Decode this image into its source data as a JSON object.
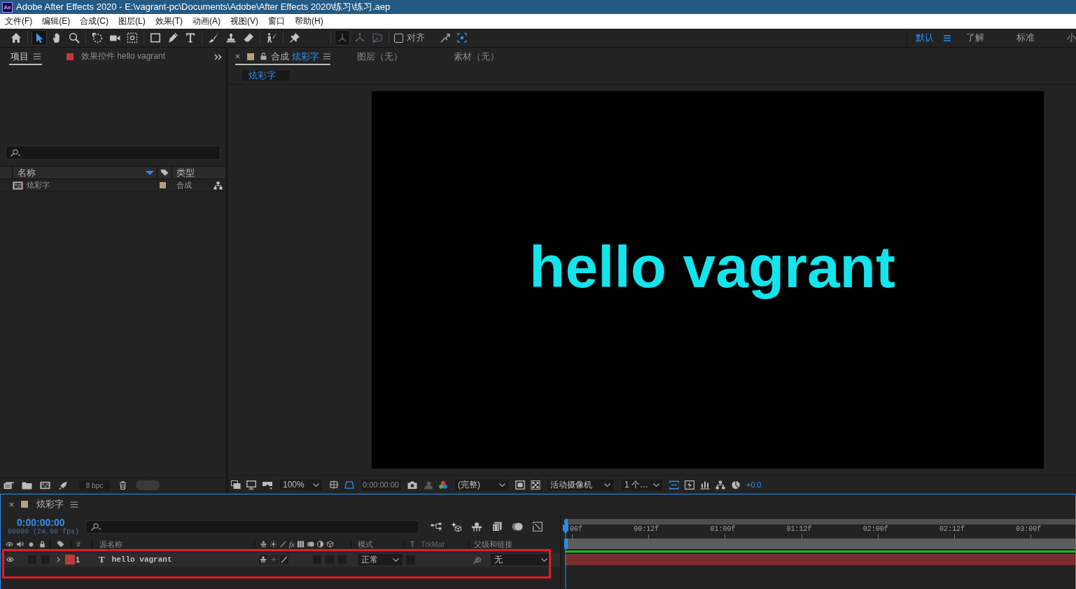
{
  "window": {
    "app_icon": "Ae",
    "title": "Adobe After Effects 2020 - E:\\vagrant-pc\\Documents\\Adobe\\After Effects 2020\\练习\\练习.aep"
  },
  "menu": [
    "文件(F)",
    "编辑(E)",
    "合成(C)",
    "图层(L)",
    "效果(T)",
    "动画(A)",
    "视图(V)",
    "窗口",
    "帮助(H)"
  ],
  "toolbar": {
    "tool_groups": [
      [
        {
          "kind": "home",
          "selected": false,
          "disabled": false
        }
      ],
      [
        {
          "kind": "selection",
          "selected": true,
          "disabled": false
        },
        {
          "kind": "hand",
          "selected": false,
          "disabled": false
        },
        {
          "kind": "zoom",
          "selected": false,
          "disabled": false
        }
      ],
      [
        {
          "kind": "rotate",
          "selected": false,
          "disabled": false
        },
        {
          "kind": "camera",
          "selected": false,
          "disabled": false
        },
        {
          "kind": "pan-behind",
          "selected": false,
          "disabled": false
        }
      ],
      [
        {
          "kind": "rectangle",
          "selected": false,
          "disabled": false
        },
        {
          "kind": "pen",
          "selected": false,
          "disabled": false
        },
        {
          "kind": "type",
          "selected": false,
          "disabled": false
        }
      ],
      [
        {
          "kind": "brush",
          "selected": false,
          "disabled": false
        },
        {
          "kind": "stamp",
          "selected": false,
          "disabled": false
        },
        {
          "kind": "eraser",
          "selected": false,
          "disabled": false
        }
      ],
      [
        {
          "kind": "roto",
          "selected": false,
          "disabled": false
        }
      ],
      [
        {
          "kind": "puppet",
          "selected": false,
          "disabled": false
        }
      ],
      [
        {
          "kind": "local-axis",
          "selected": true,
          "disabled": true
        },
        {
          "kind": "world-axis",
          "selected": false,
          "disabled": true
        },
        {
          "kind": "view-axis",
          "selected": false,
          "disabled": true
        }
      ]
    ],
    "snap": {
      "label": "对齐",
      "checked": false
    },
    "workspaces": [
      {
        "label": "默认",
        "selected": true
      },
      {
        "label": "了解",
        "selected": false
      },
      {
        "label": "标准",
        "selected": false
      },
      {
        "label": "小",
        "selected": false
      }
    ]
  },
  "project_panel": {
    "tabs": [
      {
        "label": "项目",
        "selected": true
      },
      {
        "label": "效果控件 hello vagrant",
        "selected": false
      }
    ],
    "columns": [
      "名称",
      "类型"
    ],
    "items": [
      {
        "name": "炫彩字",
        "type": "合成",
        "color": "#b4a07e"
      }
    ],
    "bit_depth": "8 bpc"
  },
  "comp_panel": {
    "tabs": [
      {
        "label": "合成",
        "name": "炫彩字",
        "selected": true
      },
      {
        "label": "图层（无）",
        "selected": false
      },
      {
        "label": "素材（无）",
        "selected": false
      }
    ],
    "breadcrumb": "炫彩字",
    "canvas_text": "hello vagrant",
    "viewer_bar": {
      "zoom": "100%",
      "mask_toggle_on": true,
      "timecode": "0:00:00:00",
      "resolution": "(完整)",
      "camera": "活动摄像机",
      "views": "1 个…",
      "aspect_toggle_on": true,
      "exposure": "+0.0"
    }
  },
  "timeline": {
    "tab": "炫彩字",
    "timecode": "0:00:00:00",
    "frame_info": "00000 (24.00 fps)",
    "columns": {
      "number": "#",
      "source": "源名称",
      "effects_flag": "fx",
      "mode": "模式",
      "trkmat_flag": "T",
      "trkmat": "TrkMat",
      "parent": "父级和链接"
    },
    "layers": [
      {
        "visible": true,
        "expanded": false,
        "color": "#c0393b",
        "index": "1",
        "type_icon": "T",
        "name": "hello vagrant",
        "switches": [
          {
            "kind": "shy",
            "on": true
          },
          {
            "kind": "collapse",
            "on": false
          },
          {
            "kind": "quality",
            "on": true
          }
        ],
        "mode": "正常",
        "parent": "无"
      }
    ],
    "ruler": [
      "00f",
      "00:12f",
      "01:00f",
      "01:12f",
      "02:00f",
      "02:12f",
      "03:00f"
    ]
  }
}
